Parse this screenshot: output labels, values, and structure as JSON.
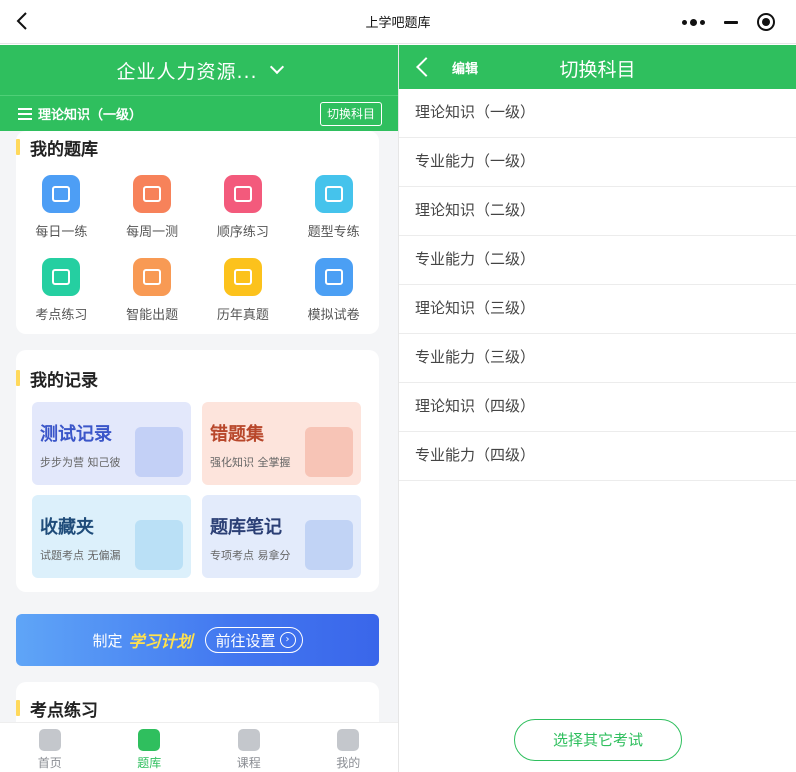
{
  "topbar": {
    "title": "上学吧题库"
  },
  "left": {
    "exam_name": "企业人力资源...",
    "current_subject": "理论知识（一级）",
    "switch_label": "切换科目",
    "question_bank": {
      "title": "我的题库",
      "items": [
        {
          "label": "每日一练",
          "color": "#4d9ef5"
        },
        {
          "label": "每周一测",
          "color": "#f7825a"
        },
        {
          "label": "顺序练习",
          "color": "#f35a7c"
        },
        {
          "label": "题型专练",
          "color": "#45c3ec"
        },
        {
          "label": "考点练习",
          "color": "#25cfa1"
        },
        {
          "label": "智能出题",
          "color": "#f89a54"
        },
        {
          "label": "历年真题",
          "color": "#fcc21c"
        },
        {
          "label": "模拟试卷",
          "color": "#4b9ff4"
        }
      ]
    },
    "records": {
      "title": "我的记录",
      "items": [
        {
          "title": "测试记录",
          "sub": "步步为营 知己彼",
          "bg": "#e3e8fb",
          "color": "#3b56c9",
          "deco": "#a9bcf2"
        },
        {
          "title": "错题集",
          "sub": "强化知识 全掌握",
          "bg": "#fde4dc",
          "color": "#b8472b",
          "deco": "#f3a998"
        },
        {
          "title": "收藏夹",
          "sub": "试题考点 无偏漏",
          "bg": "#dcf0fb",
          "color": "#1f4c7a",
          "deco": "#9fd3f2"
        },
        {
          "title": "题库笔记",
          "sub": "专项考点 易拿分",
          "bg": "#e3ebfb",
          "color": "#2b3f75",
          "deco": "#a6bff0"
        }
      ]
    },
    "banner": {
      "prefix": "制定",
      "highlight": "学习计划",
      "button": "前往设置"
    },
    "points": {
      "title": "考点练习"
    },
    "tabs": [
      {
        "label": "首页",
        "active": false
      },
      {
        "label": "题库",
        "active": true
      },
      {
        "label": "课程",
        "active": false
      },
      {
        "label": "我的",
        "active": false
      }
    ]
  },
  "right": {
    "edit_label": "编辑",
    "title": "切换科目",
    "subjects": [
      "理论知识（一级）",
      "专业能力（一级）",
      "理论知识（二级）",
      "专业能力（二级）",
      "理论知识（三级）",
      "专业能力（三级）",
      "理论知识（四级）",
      "专业能力（四级）"
    ],
    "other_exam": "选择其它考试"
  }
}
